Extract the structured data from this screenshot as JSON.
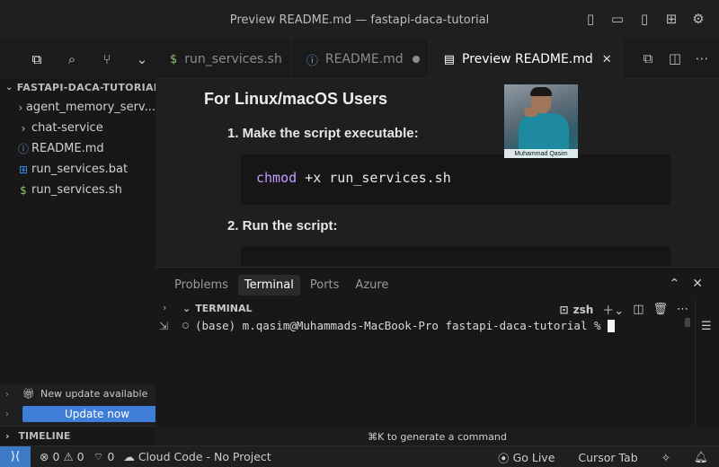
{
  "window": {
    "title": "Preview README.md — fastapi-daca-tutorial"
  },
  "sidebar": {
    "section_title": "FASTAPI-DACA-TUTORIAL",
    "items": [
      {
        "label": "agent_memory_serv...",
        "kind": "folder",
        "icon": "chevron-right-icon"
      },
      {
        "label": "chat-service",
        "kind": "folder",
        "icon": "chevron-right-icon"
      },
      {
        "label": "README.md",
        "kind": "file",
        "icon": "info-icon"
      },
      {
        "label": "run_services.bat",
        "kind": "file",
        "icon": "windows-icon"
      },
      {
        "label": "run_services.sh",
        "kind": "file",
        "icon": "dollar-icon"
      }
    ],
    "update_notice": {
      "label": "New update available",
      "button": "Update now"
    },
    "timeline_label": "TIMELINE"
  },
  "tabs": [
    {
      "label": "run_services.sh",
      "icon": "dollar-icon",
      "active": false
    },
    {
      "label": "README.md",
      "icon": "info-icon",
      "active": false,
      "modified": true
    },
    {
      "label": "Preview README.md",
      "icon": "preview-icon",
      "active": true
    }
  ],
  "preview": {
    "heading": "For Linux/macOS Users",
    "step1": "1. Make the script executable:",
    "code1_cmd": "chmod",
    "code1_args": " +x run_services.sh",
    "step2": "2. Run the script:"
  },
  "webcam": {
    "name": "Muhammad Qasim"
  },
  "panel": {
    "tabs": [
      {
        "label": "Problems",
        "active": false
      },
      {
        "label": "Terminal",
        "active": true
      },
      {
        "label": "Ports",
        "active": false
      },
      {
        "label": "Azure",
        "active": false
      }
    ],
    "terminal_title": "TERMINAL",
    "shell": "zsh",
    "prompt": "(base) m.qasim@Muhammads-MacBook-Pro fastapi-daca-tutorial %",
    "hint": "⌘K to generate a command"
  },
  "statusbar": {
    "errors": "0",
    "warnings": "0",
    "ports": "0",
    "cloud_code": "Cloud Code - No Project",
    "go_live": "Go Live",
    "cursor_tab": "Cursor Tab"
  },
  "colors": {
    "accent": "#3e7bc7",
    "update_button": "#3f7ed8"
  }
}
